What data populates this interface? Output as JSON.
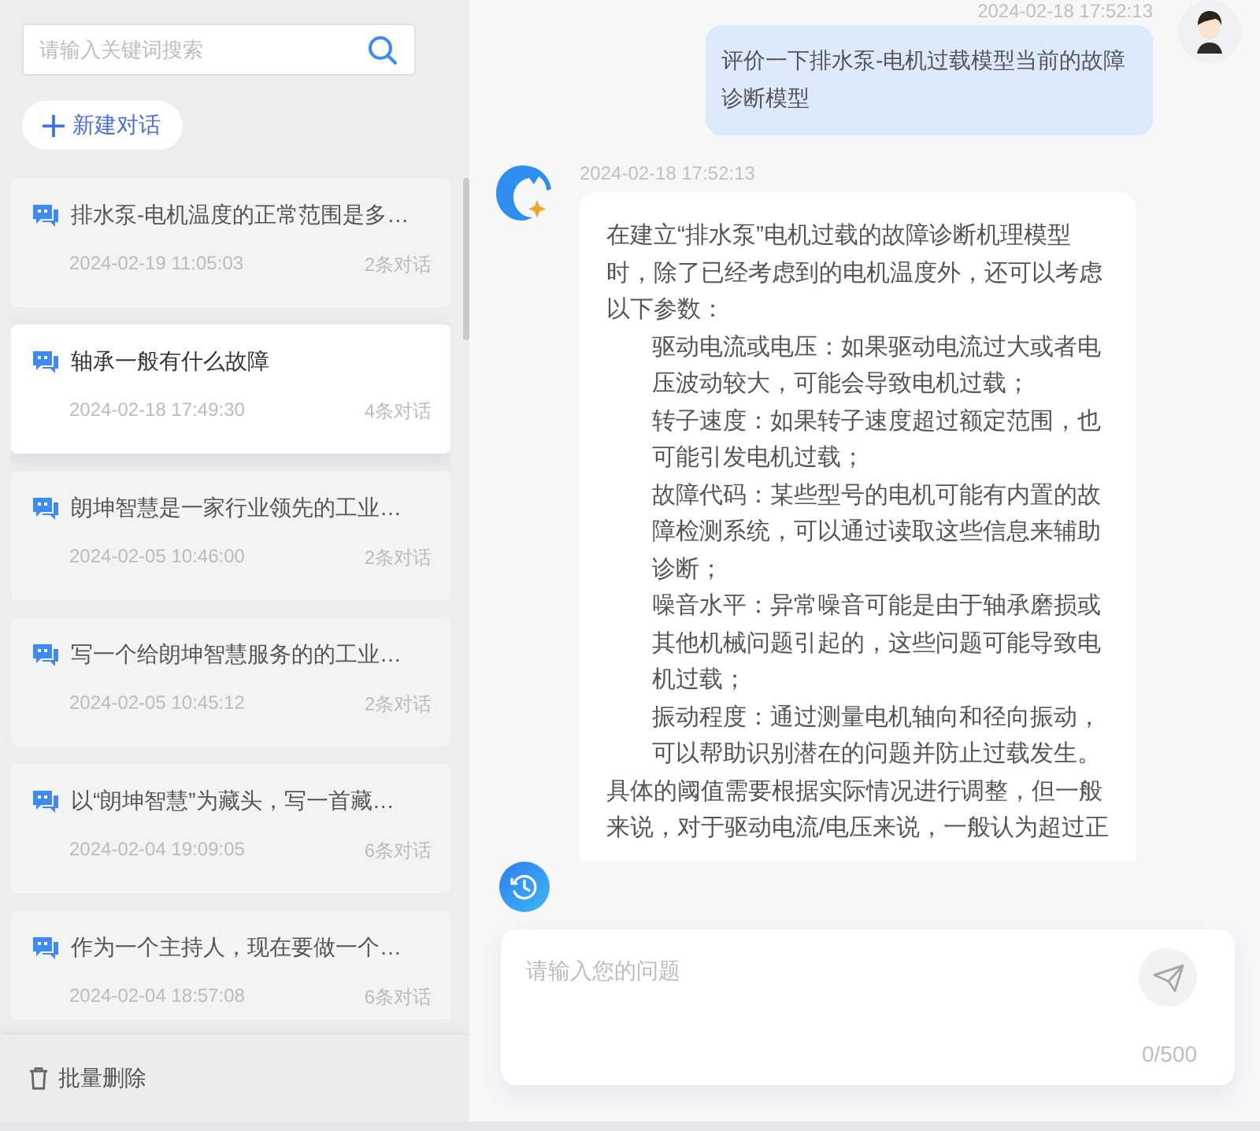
{
  "sidebar": {
    "search": {
      "placeholder": "请输入关键词搜索"
    },
    "new_chat_button": "新建对话",
    "conversations": [
      {
        "title": "排水泵-电机温度的正常范围是多…",
        "date": "2024-02-19 11:05:03",
        "count": "2条对话",
        "selected": false
      },
      {
        "title": "轴承一般有什么故障",
        "date": "2024-02-18 17:49:30",
        "count": "4条对话",
        "selected": true
      },
      {
        "title": "朗坤智慧是一家行业领先的工业…",
        "date": "2024-02-05 10:46:00",
        "count": "2条对话",
        "selected": false
      },
      {
        "title": "写一个给朗坤智慧服务的的工业…",
        "date": "2024-02-05 10:45:12",
        "count": "2条对话",
        "selected": false
      },
      {
        "title": "以“朗坤智慧”为藏头，写一首藏…",
        "date": "2024-02-04 19:09:05",
        "count": "6条对话",
        "selected": false
      },
      {
        "title": "作为一个主持人，现在要做一个…",
        "date": "2024-02-04 18:57:08",
        "count": "6条对话",
        "selected": false
      }
    ],
    "batch_delete_button": "批量删除"
  },
  "chat": {
    "messages": [
      {
        "kind": "user",
        "time": "2024-02-18 17:52:13",
        "text": "评价一下排水泵-电机过载模型当前的故障诊断模型"
      },
      {
        "kind": "assistant",
        "time": "2024-02-18 17:52:13",
        "intro": "在建立“排水泵”电机过载的故障诊断机理模型时，除了已经考虑到的电机温度外，还可以考虑以下参数：",
        "items": [
          "驱动电流或电压：如果驱动电流过大或者电压波动较大，可能会导致电机过载；",
          "转子速度：如果转子速度超过额定范围，也可能引发电机过载；",
          "故障代码：某些型号的电机可能有内置的故障检测系统，可以通过读取这些信息来辅助诊断；",
          "噪音水平：异常噪音可能是由于轴承磨损或其他机械问题引起的，这些问题可能导致电机过载；",
          "振动程度：通过测量电机轴向和径向振动，可以帮助识别潜在的问题并防止过载发生。"
        ],
        "outro": "具体的阈值需要根据实际情况进行调整，但一般来说，对于驱动电流/电压来说，一般认为超过正"
      }
    ]
  },
  "input": {
    "placeholder": "请输入您的问题",
    "counter": "0/500"
  }
}
